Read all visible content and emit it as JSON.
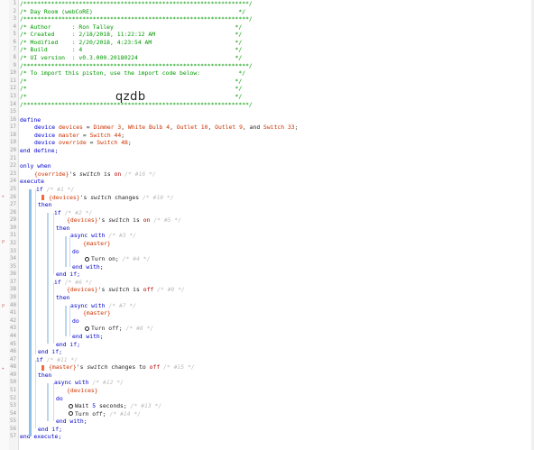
{
  "header": {
    "border_top": "/*****************************************************************/",
    "title": "/* Day Room (webCoRE)                                          */",
    "border": "/*****************************************************************/",
    "author": "/* Author      : Ron Talley                                   */",
    "created": "/* Created     : 2/18/2018, 11:22:12 AM                       */",
    "modified": "/* Modified    : 2/20/2018, 4:23:54 AM                        */",
    "build": "/* Build       : 4                                            */",
    "ui_version": "/* UI version  : v0.3.000.20180224                            */",
    "border2": "/*****************************************************************/",
    "import1": "/* To import this piston, use the import code below:           */",
    "blank1": "/*                                                            */",
    "blank2": "/*                                                            */",
    "blank3": "/*                                                            */",
    "border3": "/*****************************************************************/",
    "import_code": "qzdb"
  },
  "code": {
    "define": "define",
    "device_kw": "device",
    "devices_var": "devices",
    "eq": " = ",
    "dimmer": "Dimmer 3",
    "white_bulb": "White Bulb 4",
    "outlet10": "Outlet 10",
    "outlet9": "Outlet 9",
    "and": "and",
    "switch33": "Switch 33",
    "master_var": "master",
    "switch44": "Switch 44",
    "override_var": "override",
    "switch48": "Switch 48",
    "end_define": "end define;",
    "only_when": "only when",
    "override_ref": "{override}",
    "s_switch": "'s",
    "switch_attr": "switch",
    "is": "is",
    "on": "on",
    "off": "off",
    "cmt_16": "/* #16 */",
    "execute": "execute",
    "if": "if",
    "then": "then",
    "cmt_1": "/* #1 */",
    "devices_ref": "{devices}",
    "changes": "changes",
    "cmt_10": "/* #10 */",
    "cmt_2": "/* #2 */",
    "cmt_5": "/* #5 */",
    "async_with": "async with",
    "cmt_3": "/* #3 */",
    "master_ref": "{master}",
    "do": "do",
    "turn_on": "Turn on;",
    "cmt_4": "/* #4 */",
    "end_with": "end with;",
    "end_if": "end if;",
    "cmt_6": "/* #6 */",
    "cmt_9": "/* #9 */",
    "cmt_7": "/* #7 */",
    "turn_off": "Turn off;",
    "cmt_8": "/* #8 */",
    "cmt_11": "/* #11 */",
    "changes_to": "changes to",
    "cmt_15": "/* #15 */",
    "cmt_12": "/* #12 */",
    "wait": "Wait",
    "five": "5",
    "seconds": "seconds;",
    "cmt_13": "/* #13 */",
    "cmt_14": "/* #14 */",
    "end_execute": "end execute;"
  },
  "line_numbers": [
    "1",
    "2",
    "3",
    "4",
    "5",
    "6",
    "7",
    "8",
    "9",
    "10",
    "11",
    "12",
    "13",
    "14",
    "15",
    "16",
    "17",
    "18",
    "19",
    "20",
    "21",
    "22",
    "23",
    "24",
    "25",
    "26",
    "27",
    "28",
    "29",
    "30",
    "31",
    "32",
    "33",
    "34",
    "35",
    "36",
    "37",
    "38",
    "39",
    "40",
    "41",
    "42",
    "43",
    "44",
    "45",
    "46",
    "47",
    "48",
    "49",
    "50",
    "51",
    "52",
    "53",
    "54",
    "55",
    "56",
    "57"
  ],
  "gutter_marks": {
    "m24": "▸",
    "m31": "P",
    "m40": "P",
    "m48": "▸"
  },
  "colors": {
    "accent": "#0000cc",
    "variable": "#cc3300",
    "comment": "#bbbbbb",
    "header": "#009900",
    "flag": "#f2693a"
  }
}
